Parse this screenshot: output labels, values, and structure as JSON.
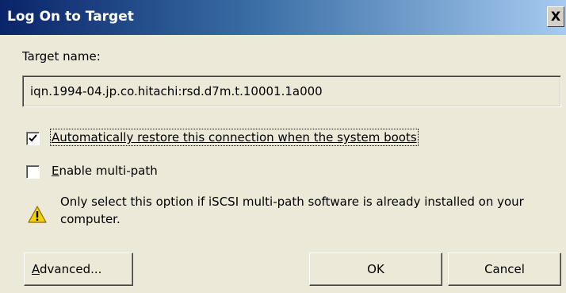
{
  "window": {
    "title": "Log On to Target",
    "close_label": "X"
  },
  "target": {
    "label": "Target name:",
    "value": "iqn.1994-04.jp.co.hitachi:rsd.d7m.t.10001.1a000"
  },
  "options": {
    "auto_restore": {
      "label": "Automatically restore this connection when the system boots",
      "checked": true
    },
    "multipath": {
      "label_mnemonic": "E",
      "label_rest": "nable multi-path",
      "checked": false
    }
  },
  "warning": {
    "icon": "warning-triangle-icon",
    "text": "Only select this option if iSCSI multi-path software is already installed on your computer."
  },
  "buttons": {
    "advanced_mnemonic": "A",
    "advanced_rest": "dvanced...",
    "ok": "OK",
    "cancel": "Cancel"
  }
}
